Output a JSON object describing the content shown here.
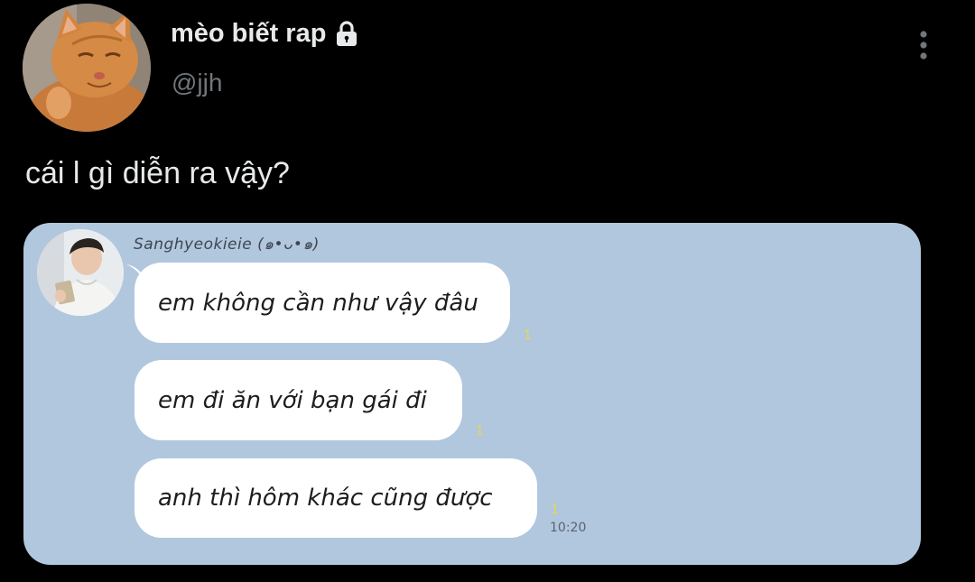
{
  "tweet": {
    "display_name": "mèo biết rap",
    "handle": "@jjh",
    "text": "cái l gì diễn ra vậy?",
    "header_icons": {
      "lock": "lock-icon",
      "more": "more-vertical-icon"
    }
  },
  "chat_screenshot": {
    "sender_name": "Sanghyeokieie (๑•ᴗ•๑)",
    "messages": [
      {
        "text": "em không cần như vậy đâu",
        "read_mark": "1"
      },
      {
        "text": "em đi ăn với bạn gái đi",
        "read_mark": "1"
      },
      {
        "text": "anh thì hôm khác cũng được",
        "read_mark": "1"
      }
    ],
    "time": "10:20"
  },
  "colors": {
    "background": "#000000",
    "text_primary": "#e7e9ea",
    "text_secondary": "#71767b",
    "chat_background": "#b1c7de",
    "bubble": "#ffffff",
    "read_mark": "#e8d64a"
  }
}
